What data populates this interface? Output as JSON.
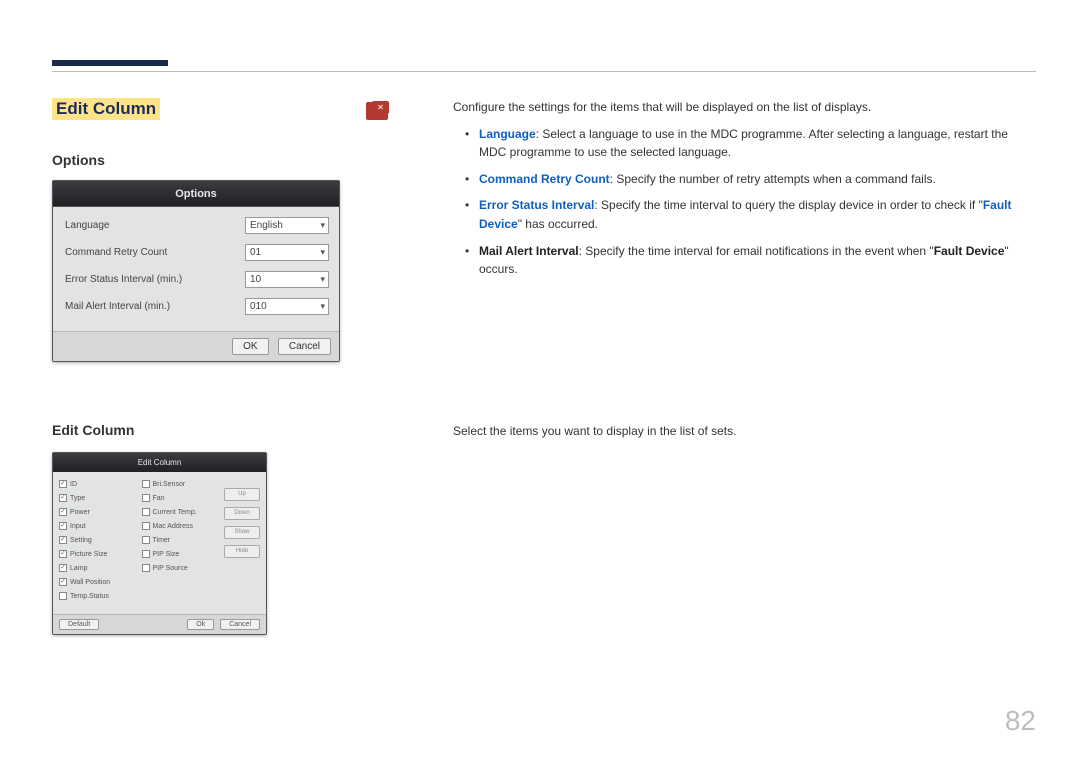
{
  "page": {
    "main_title": "Edit Column",
    "page_number": "82"
  },
  "options_section": {
    "heading": "Options",
    "dialog_title": "Options",
    "rows": {
      "language_label": "Language",
      "language_value": "English",
      "retry_label": "Command Retry Count",
      "retry_value": "01",
      "error_label": "Error Status Interval (min.)",
      "error_value": "10",
      "mail_label": "Mail Alert Interval (min.)",
      "mail_value": "010"
    },
    "ok": "OK",
    "cancel": "Cancel"
  },
  "editcol_section": {
    "heading": "Edit Column",
    "dialog_title": "Edit Column",
    "left_items": [
      "ID",
      "Type",
      "Power",
      "Input",
      "Setting",
      "Picture Size",
      "Lamp",
      "Wall Position",
      "Temp.Status"
    ],
    "left_checked": [
      true,
      true,
      true,
      true,
      true,
      true,
      true,
      true,
      false
    ],
    "right_items": [
      "Bri.Sensor",
      "Fan",
      "Current Temp.",
      "Mac Address",
      "Timer",
      "PIP Size",
      "PIP Source"
    ],
    "side_buttons": [
      "Up",
      "Down",
      "Show",
      "Hide"
    ],
    "default": "Default",
    "ok": "Ok",
    "cancel": "Cancel"
  },
  "desc": {
    "intro": "Configure the settings for the items that will be displayed on the list of displays.",
    "lang_key": "Language",
    "lang_text": ": Select a language to use in the MDC programme. After selecting a language, restart the MDC programme to use the selected language.",
    "retry_key": "Command Retry Count",
    "retry_text": ": Specify the number of retry attempts when a command fails.",
    "error_key": "Error Status Interval",
    "error_text1": ": Specify the time interval to query the display device in order to check if \"",
    "error_fault": "Fault Device",
    "error_text2": "\" has occurred.",
    "mail_key": "Mail Alert Interval",
    "mail_text1": ": Specify the time interval for email notifications in the event when \"",
    "mail_fault": "Fault Device",
    "mail_text2": "\" occurs.",
    "sec2": "Select the items you want to display in the list of sets."
  }
}
